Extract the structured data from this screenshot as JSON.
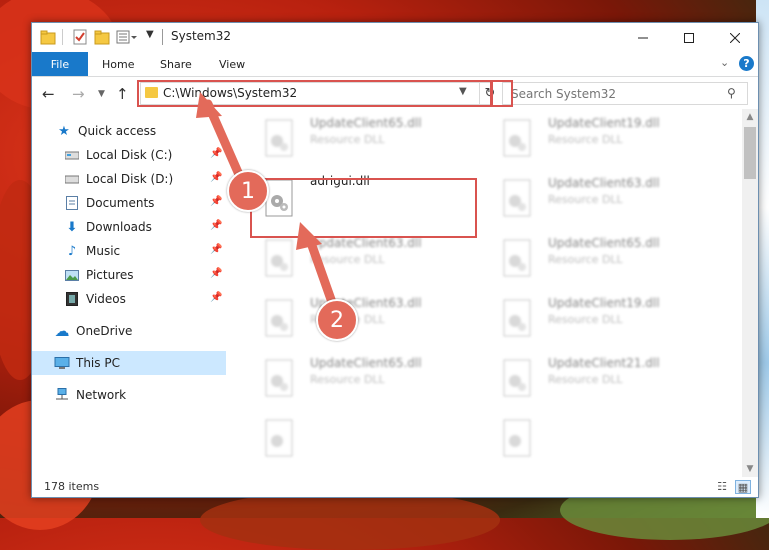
{
  "window": {
    "title": "System32"
  },
  "ribbon": {
    "file_tab": "File",
    "tabs": [
      "Home",
      "Share",
      "View"
    ]
  },
  "address": {
    "path": "C:\\Windows\\System32"
  },
  "search": {
    "placeholder": "Search System32"
  },
  "sidebar": {
    "items": [
      {
        "label": "Quick access",
        "icon": "star-icon"
      },
      {
        "label": "Local Disk (C:)",
        "icon": "drive-icon",
        "pinned": true
      },
      {
        "label": "Local Disk (D:)",
        "icon": "drive-icon",
        "pinned": true
      },
      {
        "label": "Documents",
        "icon": "documents-icon",
        "pinned": true
      },
      {
        "label": "Downloads",
        "icon": "download-icon",
        "pinned": true
      },
      {
        "label": "Music",
        "icon": "music-icon",
        "pinned": true
      },
      {
        "label": "Pictures",
        "icon": "pictures-icon",
        "pinned": true
      },
      {
        "label": "Videos",
        "icon": "videos-icon",
        "pinned": true
      },
      {
        "label": "OneDrive",
        "icon": "cloud-icon"
      },
      {
        "label": "This PC",
        "icon": "pc-icon",
        "selected": true
      },
      {
        "label": "Network",
        "icon": "network-icon"
      }
    ]
  },
  "files": {
    "col1": [
      {
        "name": "UpdateClient65.dll",
        "type": "Resource DLL"
      },
      {
        "name": "adrigui.dll",
        "type": ""
      },
      {
        "name": "UpdateClient63.dll",
        "type": "Resource DLL"
      },
      {
        "name": "UpdateClient63.dll",
        "type": "Resource DLL"
      },
      {
        "name": "UpdateClient65.dll",
        "type": "Resource DLL"
      },
      {
        "name": "",
        "type": ""
      }
    ],
    "col2": [
      {
        "name": "UpdateClient19.dll",
        "type": "Resource DLL"
      },
      {
        "name": "UpdateClient63.dll",
        "type": "Resource DLL"
      },
      {
        "name": "UpdateClient65.dll",
        "type": "Resource DLL"
      },
      {
        "name": "UpdateClient19.dll",
        "type": "Resource DLL"
      },
      {
        "name": "UpdateClient21.dll",
        "type": "Resource DLL"
      },
      {
        "name": "",
        "type": ""
      }
    ]
  },
  "status": {
    "item_count": "178 items"
  },
  "callouts": [
    "1",
    "2"
  ],
  "colors": {
    "accent": "#1979ca",
    "highlight_box": "#d9534f",
    "callout": "#e36a5a",
    "selected": "#cce8ff"
  }
}
